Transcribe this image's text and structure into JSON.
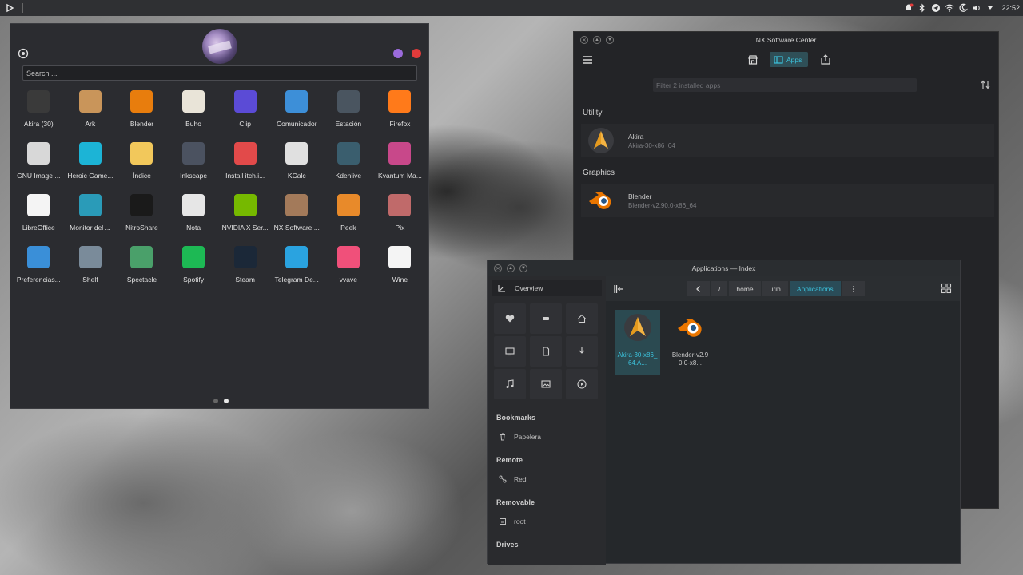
{
  "topbar": {
    "clock": "22:52"
  },
  "launcher": {
    "search_placeholder": "Search ...",
    "apps": [
      {
        "label": "Akira (30)",
        "icon": "akira-icon",
        "color": "#3a3a3a"
      },
      {
        "label": "Ark",
        "icon": "ark-icon",
        "color": "#c9955a"
      },
      {
        "label": "Blender",
        "icon": "blender-icon",
        "color": "#e87d0d"
      },
      {
        "label": "Buho",
        "icon": "buho-icon",
        "color": "#e9e4d8"
      },
      {
        "label": "Clip",
        "icon": "clip-icon",
        "color": "#5b4bd6"
      },
      {
        "label": "Comunicador",
        "icon": "comunicador-icon",
        "color": "#3d8fd8"
      },
      {
        "label": "Estación",
        "icon": "estacion-icon",
        "color": "#4a5560"
      },
      {
        "label": "Firefox",
        "icon": "firefox-icon",
        "color": "#ff7a1a"
      },
      {
        "label": "GNU Image ...",
        "icon": "gimp-icon",
        "color": "#d8d8d8"
      },
      {
        "label": "Heroic Game...",
        "icon": "heroic-icon",
        "color": "#1cb4d6"
      },
      {
        "label": "Índice",
        "icon": "folder-icon",
        "color": "#f2c85b"
      },
      {
        "label": "Inkscape",
        "icon": "inkscape-icon",
        "color": "#4b5260"
      },
      {
        "label": "Install itch.i...",
        "icon": "itch-icon",
        "color": "#e24a4a"
      },
      {
        "label": "KCalc",
        "icon": "kcalc-icon",
        "color": "#e0e0e0"
      },
      {
        "label": "Kdenlive",
        "icon": "kdenlive-icon",
        "color": "#3a5e6e"
      },
      {
        "label": "Kvantum Ma...",
        "icon": "kvantum-icon",
        "color": "#c8488a"
      },
      {
        "label": "LibreOffice",
        "icon": "libreoffice-icon",
        "color": "#f4f4f4"
      },
      {
        "label": "Monitor del ...",
        "icon": "monitor-icon",
        "color": "#2a9bb8"
      },
      {
        "label": "NitroShare",
        "icon": "nitroshare-icon",
        "color": "#1a1a1a"
      },
      {
        "label": "Nota",
        "icon": "nota-icon",
        "color": "#e6e6e6"
      },
      {
        "label": "NVIDIA X Ser...",
        "icon": "nvidia-icon",
        "color": "#76b900"
      },
      {
        "label": "NX Software ...",
        "icon": "nx-software-icon",
        "color": "#a37a5a"
      },
      {
        "label": "Peek",
        "icon": "peek-icon",
        "color": "#e88a2a"
      },
      {
        "label": "Pix",
        "icon": "pix-icon",
        "color": "#c06a6a"
      },
      {
        "label": "Preferencias...",
        "icon": "preferences-icon",
        "color": "#3a8fd8"
      },
      {
        "label": "Shelf",
        "icon": "shelf-icon",
        "color": "#7a8b9a"
      },
      {
        "label": "Spectacle",
        "icon": "spectacle-icon",
        "color": "#4aa06a"
      },
      {
        "label": "Spotify",
        "icon": "spotify-icon",
        "color": "#1db954"
      },
      {
        "label": "Steam",
        "icon": "steam-icon",
        "color": "#1b2838"
      },
      {
        "label": "Telegram De...",
        "icon": "telegram-icon",
        "color": "#2aa3e0"
      },
      {
        "label": "vvave",
        "icon": "vvave-icon",
        "color": "#f0507a"
      },
      {
        "label": "Wine",
        "icon": "wine-icon",
        "color": "#f4f4f4"
      }
    ]
  },
  "nx": {
    "title": "NX Software Center",
    "apps_label": "Apps",
    "filter_placeholder": "Filter 2 installed apps",
    "sections": [
      {
        "title": "Utility",
        "items": [
          {
            "name": "Akira",
            "sub": "Akira-30-x86_64"
          }
        ]
      },
      {
        "title": "Graphics",
        "items": [
          {
            "name": "Blender",
            "sub": "Blender-v2.90.0-x86_64"
          }
        ]
      }
    ]
  },
  "index": {
    "title": "Applications — Index",
    "overview": "Overview",
    "bookmarks_title": "Bookmarks",
    "bookmark_item": "Papelera",
    "remote_title": "Remote",
    "remote_item": "Red",
    "removable_title": "Removable",
    "removable_item": "root",
    "drives_title": "Drives",
    "crumbs": [
      "/",
      "home",
      "urih",
      "Applications"
    ],
    "files": [
      "Akira-30-x86_64.A...",
      "Blender-v2.90.0-x8..."
    ]
  },
  "colors": {
    "accent": "#3cc3dd",
    "accent_bg": "#2a4c58"
  }
}
